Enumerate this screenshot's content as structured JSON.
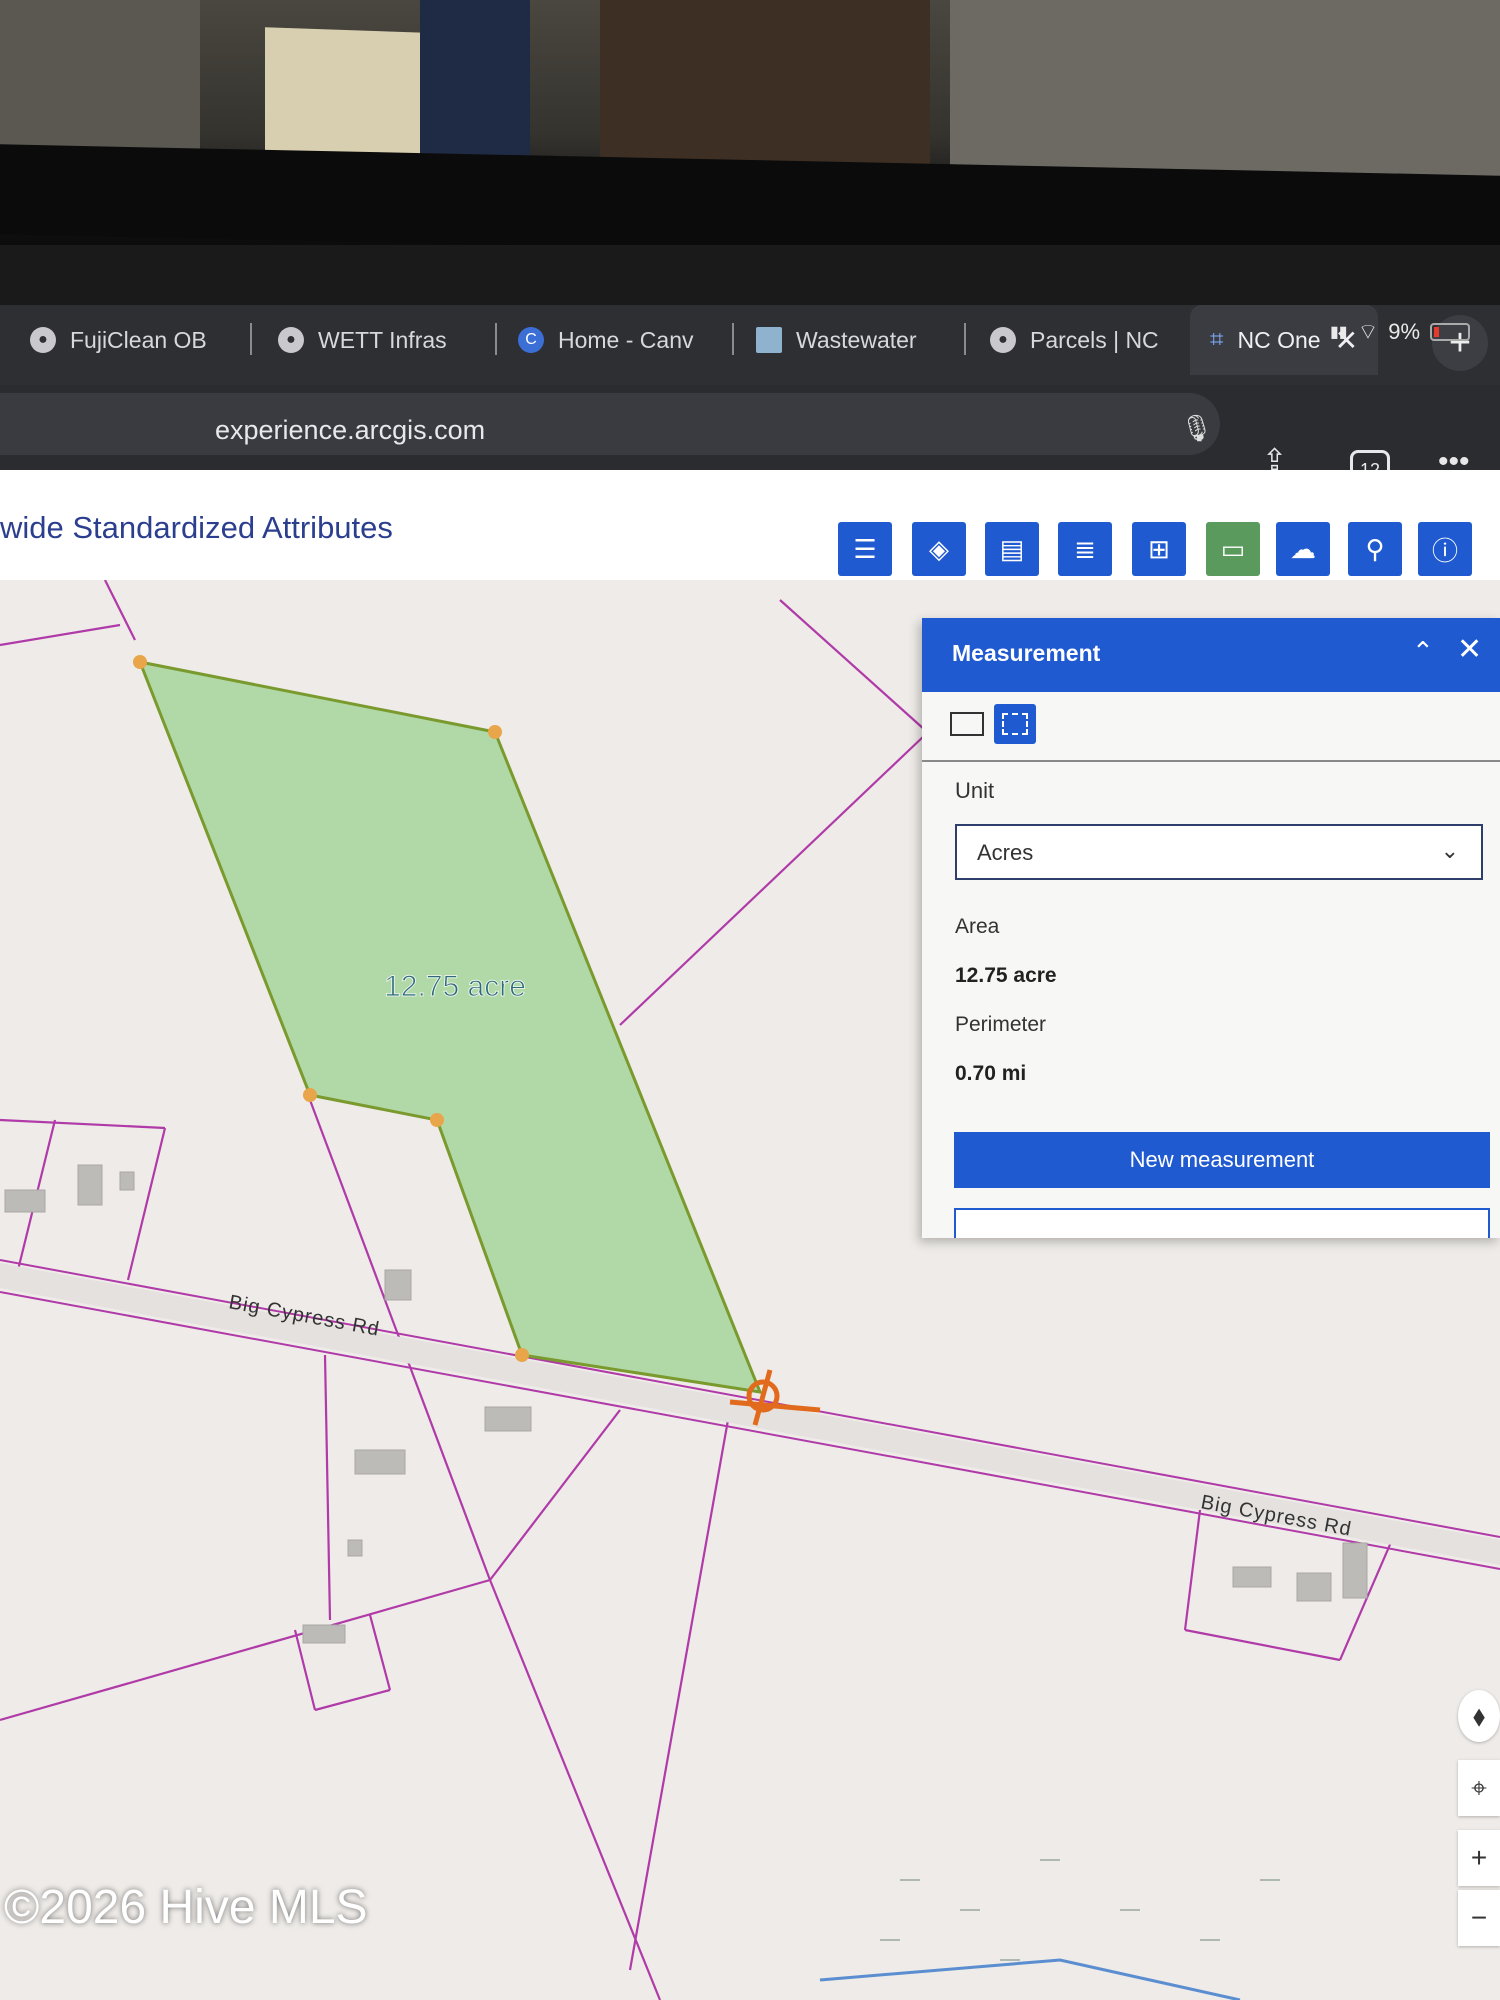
{
  "browser": {
    "tabs": [
      {
        "label": "FujiClean OB",
        "icon": "globe-icon"
      },
      {
        "label": "WETT Infras",
        "icon": "globe-icon"
      },
      {
        "label": "Home - Canv",
        "icon": "canvas-c-icon"
      },
      {
        "label": "Wastewater",
        "icon": "site-thumbnail-icon"
      },
      {
        "label": "Parcels | NC",
        "icon": "globe-icon"
      },
      {
        "label": "NC One",
        "icon": "map-frame-icon"
      }
    ],
    "status_battery": "9%",
    "url": "experience.arcgis.com",
    "tab_count": "12"
  },
  "app": {
    "title": "wide Standardized Attributes"
  },
  "measurement": {
    "title": "Measurement",
    "unit_label": "Unit",
    "unit_value": "Acres",
    "area_label": "Area",
    "area_value": "12.75 acre",
    "perimeter_label": "Perimeter",
    "perimeter_value": "0.70 mi",
    "new_button": "New measurement"
  },
  "map": {
    "polygon_label": "12.75 acre",
    "roads": [
      "Big Cypress Rd",
      "Big Cypress Rd"
    ],
    "zoom_in": "+",
    "zoom_out": "−"
  },
  "watermark": "©2026 Hive MLS",
  "colors": {
    "accent": "#1f5ad1",
    "parcel_line": "#b03aa8",
    "polygon_fill": "#a6d59b"
  }
}
